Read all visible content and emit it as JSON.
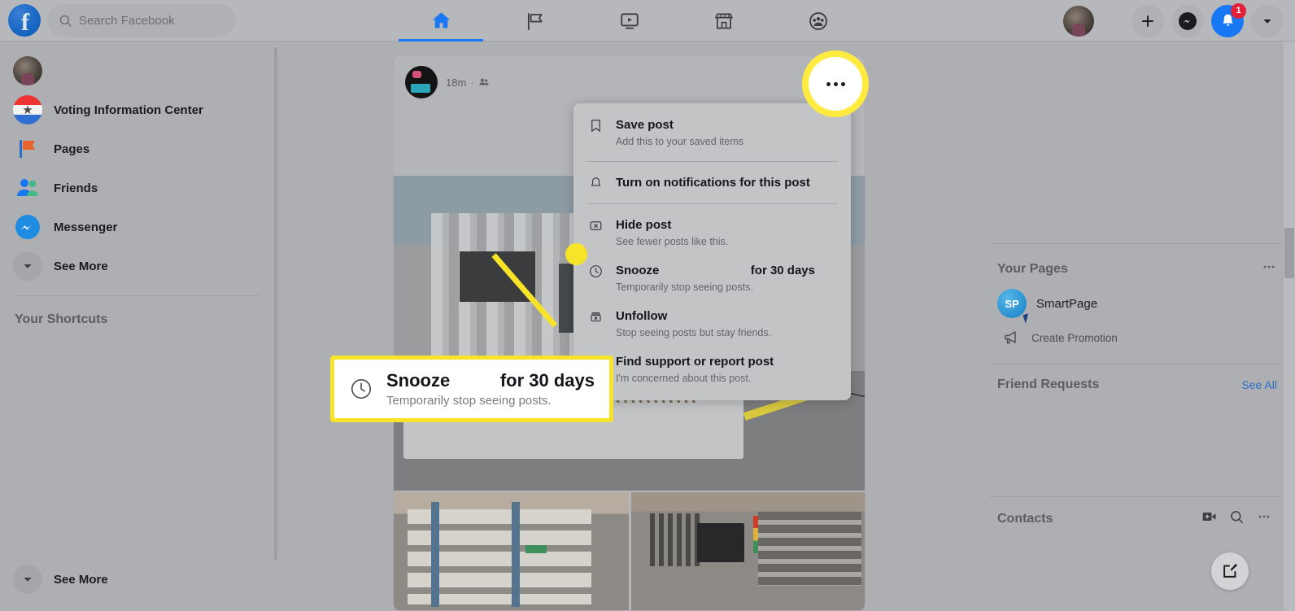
{
  "header": {
    "logo_icon": "facebook-logo-icon",
    "logo_letter": "f",
    "search": {
      "icon": "search-icon",
      "placeholder": "Search Facebook",
      "value": ""
    },
    "nav_tabs": [
      {
        "icon": "home-icon",
        "name": "home",
        "active": true
      },
      {
        "icon": "flag-pages-icon",
        "name": "pages",
        "active": false
      },
      {
        "icon": "watch-video-icon",
        "name": "watch",
        "active": false
      },
      {
        "icon": "marketplace-store-icon",
        "name": "marketplace",
        "active": false
      },
      {
        "icon": "groups-icon",
        "name": "groups",
        "active": false
      }
    ],
    "right": {
      "avatar_icon": "user-avatar",
      "plus_icon": "plus-icon",
      "messenger_icon": "messenger-icon",
      "notifications_icon": "bell-icon",
      "notifications_badge": "1",
      "account_icon": "chevron-down-icon"
    }
  },
  "sidebar": {
    "items": [
      {
        "label": "",
        "icon": "user-avatar"
      },
      {
        "label": "Voting Information Center",
        "icon": "voting-icon"
      },
      {
        "label": "Pages",
        "icon": "flag-pages-icon"
      },
      {
        "label": "Friends",
        "icon": "friends-icon"
      },
      {
        "label": "Messenger",
        "icon": "messenger-icon"
      },
      {
        "label": "See More",
        "icon": "chevron-down-icon"
      }
    ],
    "shortcuts_title": "Your Shortcuts",
    "see_more_bottom": "See More"
  },
  "post": {
    "timestamp": "18m",
    "separator": "·",
    "audience_icon": "friends-audience-icon",
    "options_icon": "ellipsis-icon"
  },
  "menu": {
    "items": [
      {
        "icon": "bookmark-icon",
        "title": "Save post",
        "suffix": "",
        "subtitle": "Add this to your saved items",
        "divider_after": true
      },
      {
        "icon": "bell-icon",
        "title": "Turn on notifications for this post",
        "suffix": "",
        "subtitle": "",
        "divider_after": true
      },
      {
        "icon": "hide-x-box-icon",
        "title": "Hide post",
        "suffix": "",
        "subtitle": "See fewer posts like this.",
        "divider_after": false
      },
      {
        "icon": "clock-icon",
        "title": "Snooze",
        "suffix": "for 30 days",
        "subtitle": "Temporarily stop seeing posts.",
        "divider_after": false
      },
      {
        "icon": "unfollow-icon",
        "title": "Unfollow",
        "suffix": "",
        "subtitle": "Stop seeing posts but stay friends.",
        "divider_after": false
      },
      {
        "icon": "report-flag-icon",
        "title": "Find support or report post",
        "suffix": "",
        "subtitle": "I'm concerned about this post.",
        "divider_after": false
      }
    ]
  },
  "callout": {
    "icon": "clock-icon",
    "title": "Snooze",
    "suffix": "for 30 days",
    "subtitle": "Temporarily stop seeing posts."
  },
  "rightbar": {
    "your_pages": {
      "title": "Your Pages",
      "more_icon": "ellipsis-icon",
      "page_name": "SmartPage",
      "page_initials": "SP",
      "create_promotion": "Create Promotion",
      "promotion_icon": "megaphone-icon"
    },
    "friend_requests": {
      "title": "Friend Requests",
      "see_all": "See All"
    },
    "contacts": {
      "title": "Contacts",
      "video_icon": "new-video-call-icon",
      "search_icon": "search-icon",
      "more_icon": "ellipsis-icon"
    }
  },
  "fab": {
    "icon": "compose-pencil-icon"
  },
  "colors": {
    "accent_blue": "#1877f2",
    "highlight_yellow": "#f7e429",
    "badge_red": "#e3203b",
    "page_bg": "#aeafb3",
    "menu_bg": "#c3c4c6"
  }
}
